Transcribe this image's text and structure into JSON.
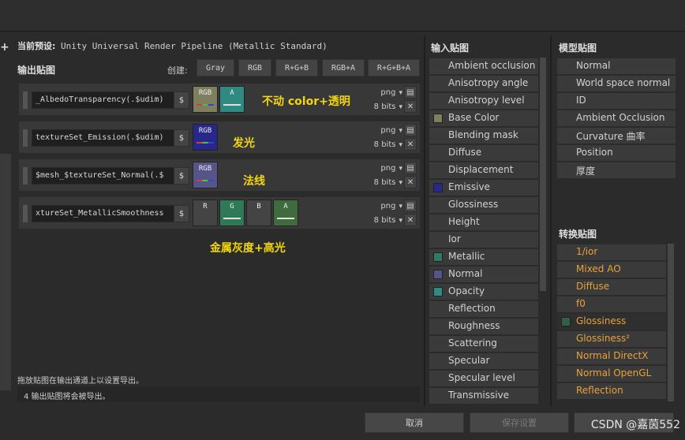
{
  "preset": {
    "label": "当前预设:",
    "value": " Unity Universal Render Pipeline (Metallic Standard)"
  },
  "output": {
    "title": "输出贴图",
    "create_label": "创建:",
    "create_buttons": [
      "Gray",
      "RGB",
      "R+G+B",
      "RGB+A",
      "R+G+B+A"
    ],
    "rows": [
      {
        "name": "_AlbedoTransparency(.$udim)",
        "format": "png",
        "bits": "8 bits",
        "note": "不动 color+透明",
        "channels": [
          {
            "label": "RGB",
            "color": "#7f7f5f",
            "bar": [
              "#c84040",
              "#40c840",
              "#4040c8"
            ]
          },
          {
            "label": "A",
            "color": "#2f8a84",
            "bar": [
              "#e0e0e0"
            ]
          }
        ]
      },
      {
        "name": "textureSet_Emission(.$udim)",
        "format": "png",
        "bits": "8 bits",
        "note": "发光",
        "channels": [
          {
            "label": "RGB",
            "color": "#28288a",
            "bar": [
              "#c84040",
              "#40c840",
              "#4040c8"
            ]
          }
        ]
      },
      {
        "name": "$mesh_$textureSet_Normal(.$",
        "format": "png",
        "bits": "8 bits",
        "note": "法线",
        "channels": [
          {
            "label": "RGB",
            "color": "#55558a",
            "bar": [
              "#c84040",
              "#40c840",
              "#4040c8"
            ]
          }
        ]
      },
      {
        "name": "xtureSet_MetallicSmoothness",
        "format": "png",
        "bits": "8 bits",
        "note": "金属灰度+高光",
        "channels": [
          {
            "label": "R",
            "color": "#444444",
            "bar": []
          },
          {
            "label": "G",
            "color": "#2f7a56",
            "bar": [
              "#e0e0e0"
            ]
          },
          {
            "label": "B",
            "color": "#444444",
            "bar": []
          },
          {
            "label": "A",
            "color": "#3f6b3f",
            "bar": [
              "#e0e0e0"
            ]
          }
        ]
      }
    ],
    "dollar": "$",
    "hint": "拖放贴图在输出通道上以设置导出。",
    "status": "4 输出贴图将会被导出。"
  },
  "input": {
    "title": "输入贴图",
    "items": [
      {
        "label": "Ambient occlusion",
        "swatch": ""
      },
      {
        "label": "Anisotropy angle",
        "swatch": ""
      },
      {
        "label": "Anisotropy level",
        "swatch": ""
      },
      {
        "label": "Base Color",
        "swatch": "#7f7f5f"
      },
      {
        "label": "Blending mask",
        "swatch": ""
      },
      {
        "label": "Diffuse",
        "swatch": ""
      },
      {
        "label": "Displacement",
        "swatch": ""
      },
      {
        "label": "Emissive",
        "swatch": "#28288a"
      },
      {
        "label": "Glossiness",
        "swatch": ""
      },
      {
        "label": "Height",
        "swatch": ""
      },
      {
        "label": "Ior",
        "swatch": ""
      },
      {
        "label": "Metallic",
        "swatch": "#2f7a66"
      },
      {
        "label": "Normal",
        "swatch": "#55558a"
      },
      {
        "label": "Opacity",
        "swatch": "#2f8a84"
      },
      {
        "label": "Reflection",
        "swatch": ""
      },
      {
        "label": "Roughness",
        "swatch": ""
      },
      {
        "label": "Scattering",
        "swatch": ""
      },
      {
        "label": "Specular",
        "swatch": ""
      },
      {
        "label": "Specular level",
        "swatch": ""
      },
      {
        "label": "Transmissive",
        "swatch": ""
      }
    ]
  },
  "model": {
    "title": "模型贴图",
    "items": [
      "Normal",
      "World space normal",
      "ID",
      "Ambient Occlusion",
      "Curvature 曲率",
      "Position",
      "厚度"
    ]
  },
  "convert": {
    "title": "转换贴图",
    "items": [
      {
        "label": "1/ior",
        "selected": false
      },
      {
        "label": "Mixed AO",
        "selected": false
      },
      {
        "label": "Diffuse",
        "selected": false
      },
      {
        "label": "f0",
        "selected": false
      },
      {
        "label": "Glossiness",
        "selected": true,
        "swatch": "#2f5f4a"
      },
      {
        "label": "Glossiness²",
        "selected": false
      },
      {
        "label": "Normal DirectX",
        "selected": false
      },
      {
        "label": "Normal OpenGL",
        "selected": false
      },
      {
        "label": "Reflection",
        "selected": false
      }
    ]
  },
  "footer": {
    "cancel": "取消",
    "save": "保存设置",
    "watermark": "CSDN @嘉茵552"
  },
  "colors": {
    "note": "#f2d60f",
    "convert_text": "#e8a23a"
  }
}
